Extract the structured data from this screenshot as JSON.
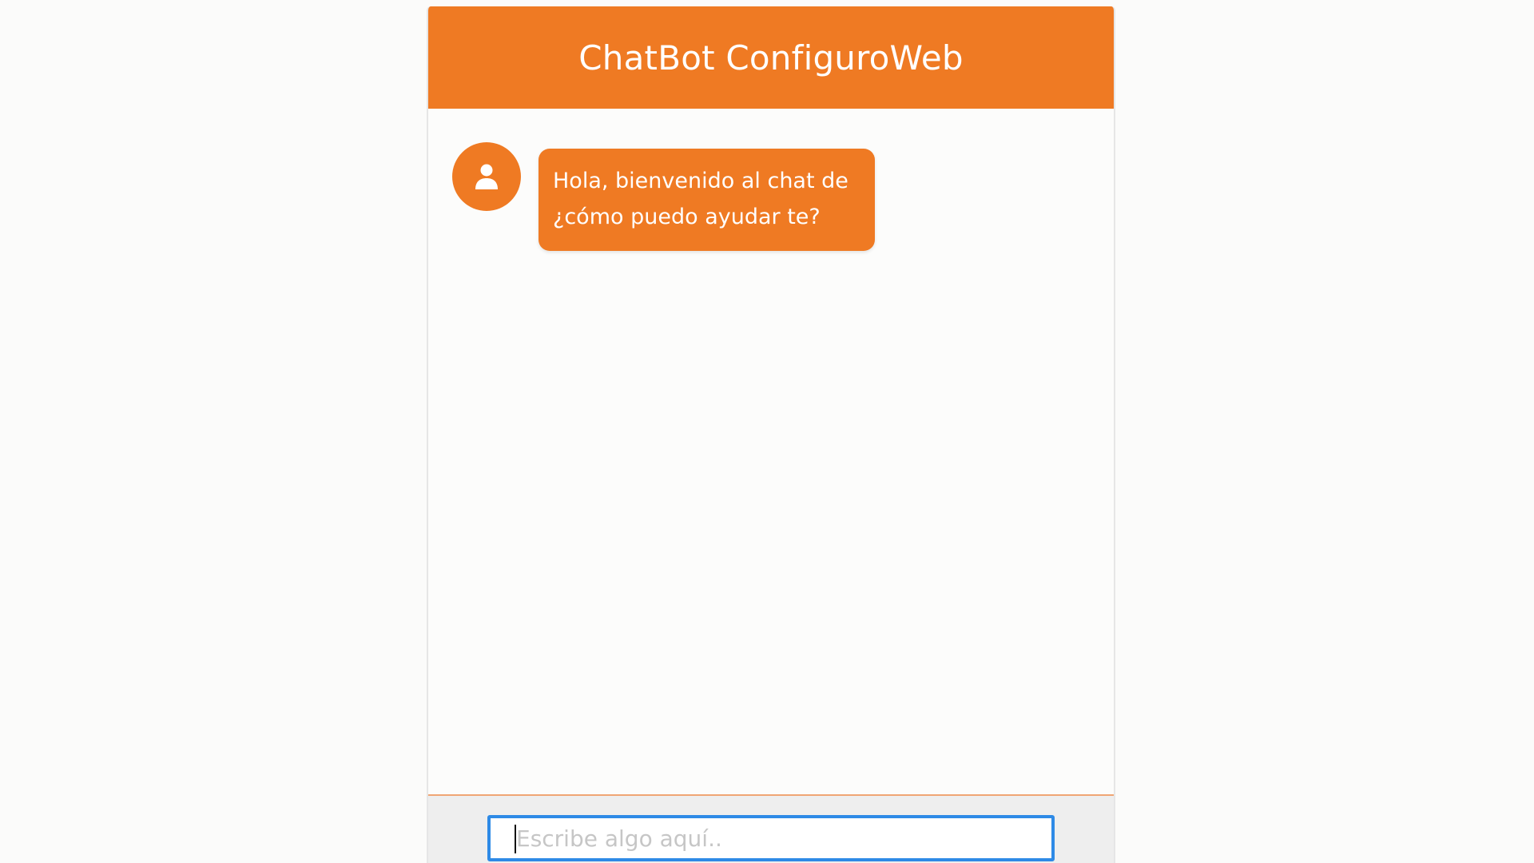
{
  "header": {
    "title": "ChatBot ConfiguroWeb"
  },
  "messages": [
    {
      "sender": "bot",
      "avatar_icon": "user-icon",
      "text": "Hola, bienvenido al chat de ¿cómo puedo ayudar te?"
    }
  ],
  "input": {
    "placeholder": "Escribe algo aquí..",
    "value": ""
  },
  "colors": {
    "brand": "#ef7a23",
    "focus": "#2e8ae6",
    "background": "#fbfbfa"
  }
}
